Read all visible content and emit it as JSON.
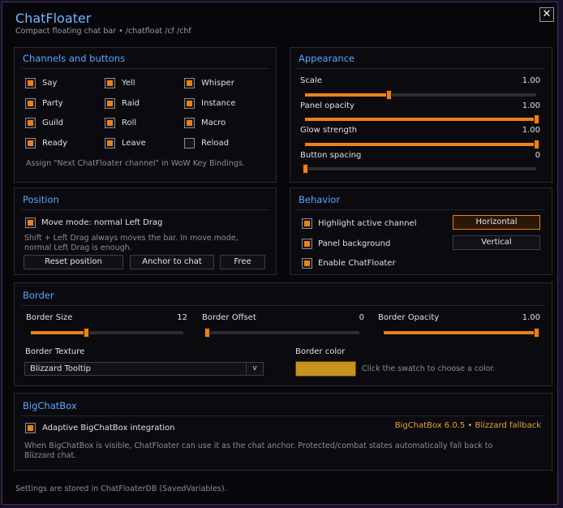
{
  "header": {
    "title": "ChatFloater",
    "subtitle": "Compact floating chat bar • /chatfloat /cf /chf",
    "close_glyph": "✕"
  },
  "channels": {
    "title": "Channels and buttons",
    "items": [
      {
        "label": "Say",
        "checked": true
      },
      {
        "label": "Yell",
        "checked": true
      },
      {
        "label": "Whisper",
        "checked": true
      },
      {
        "label": "Party",
        "checked": true
      },
      {
        "label": "Raid",
        "checked": true
      },
      {
        "label": "Instance",
        "checked": true
      },
      {
        "label": "Guild",
        "checked": true
      },
      {
        "label": "Roll",
        "checked": true
      },
      {
        "label": "Macro",
        "checked": true
      },
      {
        "label": "Ready",
        "checked": true
      },
      {
        "label": "Leave",
        "checked": true
      },
      {
        "label": "Reload",
        "checked": false
      }
    ],
    "hint": "Assign \"Next ChatFloater channel\" in WoW Key Bindings."
  },
  "appearance": {
    "title": "Appearance",
    "sliders": [
      {
        "label": "Scale",
        "value": "1.00",
        "fraction": 0.36
      },
      {
        "label": "Panel opacity",
        "value": "1.00",
        "fraction": 1.0
      },
      {
        "label": "Glow strength",
        "value": "1.00",
        "fraction": 1.0
      },
      {
        "label": "Button spacing",
        "value": "0",
        "fraction": 0.0
      }
    ]
  },
  "position": {
    "title": "Position",
    "move_mode": {
      "label": "Move mode: normal Left Drag",
      "checked": true
    },
    "hint_line1": "Shift + Left Drag always moves the bar. In move mode,",
    "hint_line2": "normal Left Drag is enough.",
    "buttons": {
      "reset": "Reset position",
      "anchor": "Anchor to chat",
      "free": "Free"
    }
  },
  "behavior": {
    "title": "Behavior",
    "options": [
      {
        "label": "Highlight active channel",
        "checked": true
      },
      {
        "label": "Panel background",
        "checked": true
      },
      {
        "label": "Enable ChatFloater",
        "checked": true
      }
    ],
    "orientation": {
      "horizontal": "Horizontal",
      "vertical": "Vertical",
      "selected": "Horizontal"
    }
  },
  "border": {
    "title": "Border",
    "sliders": [
      {
        "label": "Border Size",
        "value": "12",
        "fraction": 0.36
      },
      {
        "label": "Border Offset",
        "value": "0",
        "fraction": 0.0
      },
      {
        "label": "Border Opacity",
        "value": "1.00",
        "fraction": 1.0
      }
    ],
    "texture_label": "Border Texture",
    "texture_value": "Blizzard Tooltip",
    "texture_chevron": "v",
    "color_label": "Border color",
    "color_hint": "Click the swatch to choose a color.",
    "color_value": "#c8921c"
  },
  "bigchatbox": {
    "title": "BigChatBox",
    "toggle": {
      "label": "Adaptive BigChatBox integration",
      "checked": true
    },
    "status": "BigChatBox 6.0.5 • Blizzard fallback",
    "desc_line1": "When BigChatBox is visible, ChatFloater can use it as the chat anchor. Protected/combat states automatically fall back to",
    "desc_line2": "Blizzard chat."
  },
  "footer": {
    "note": "Settings are stored in ChatFloaterDB (SavedVariables)."
  },
  "colors": {
    "accent": "#f07f16",
    "title_blue": "#5aa8ff"
  }
}
